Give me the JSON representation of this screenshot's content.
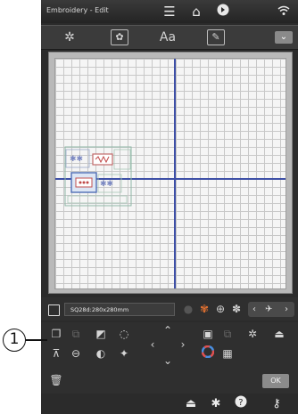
{
  "header": {
    "title": "Embroidery - Edit"
  },
  "hoop": {
    "size_label": "SQ28d:280x280mm"
  },
  "buttons": {
    "ok_label": "OK"
  },
  "annotation": {
    "callout_number": "1"
  },
  "icons": {
    "top": [
      "menu-icon",
      "home-icon",
      "help-circle-icon",
      "wifi-icon"
    ],
    "toolbar": [
      "pattern-select-icon",
      "frame-pattern-icon",
      "text-icon",
      "edit-pattern-icon",
      "dropdown-icon"
    ],
    "bottom": [
      "sewing-icon",
      "settings-icon",
      "help-icon",
      "wrench-icon"
    ]
  },
  "colors": {
    "axis": "#3d4fa6",
    "canvas_bg": "#f5f5f5",
    "panel_bg": "#2f2f2f"
  }
}
